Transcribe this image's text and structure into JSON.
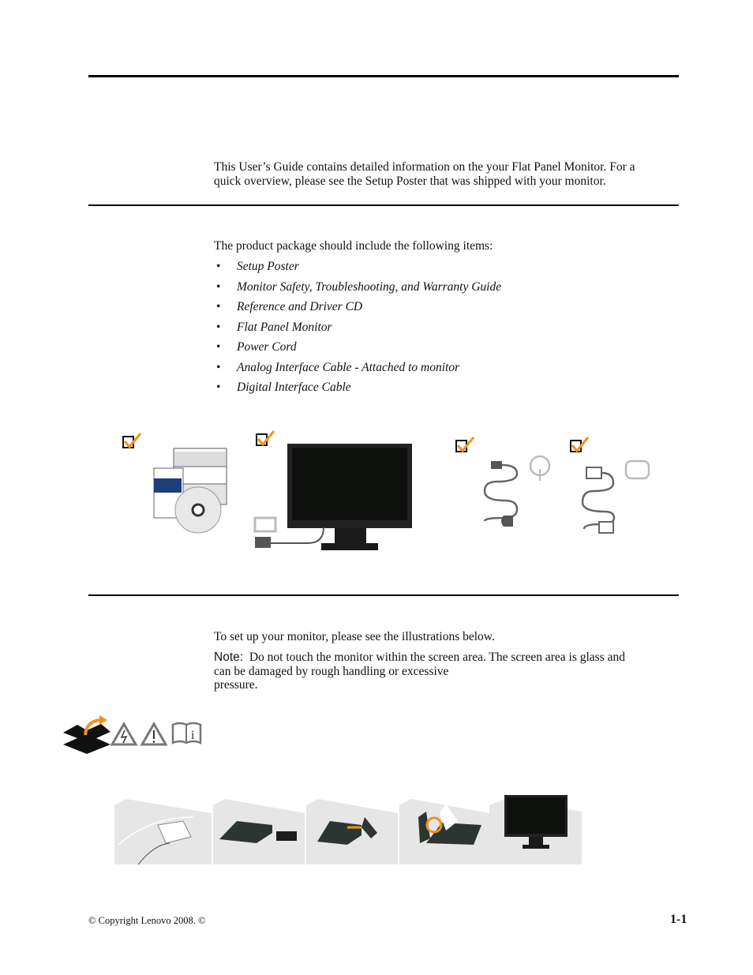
{
  "intro": {
    "line1": "This User’s Guide contains detailed information on the your Flat Panel Monitor.  For a",
    "line2": "quick overview, please see the Setup Poster that was shipped with your monitor."
  },
  "package": {
    "lead": "The product package should include the following items:",
    "items": [
      "Setup Poster",
      "Monitor Safety, Troubleshooting, and Warranty Guide",
      "Reference and Driver CD",
      "Flat Panel Monitor",
      "Power Cord",
      "Analog Interface Cable - Attached to monitor",
      "Digital Interface Cable"
    ],
    "bullet": "•",
    "accent_color": "#f0921e"
  },
  "setup": {
    "lead": "To set up your monitor, please see the illustrations below.",
    "note_label": "Note:",
    "note_line1": "Do not touch the monitor within the screen area. The screen area is glass and",
    "note_line2": "can be damaged by rough handling or excessive",
    "note_line3": "pressure."
  },
  "footer": {
    "copyright": "© Copyright Lenovo 2008. ©",
    "page_number": "1-1"
  }
}
